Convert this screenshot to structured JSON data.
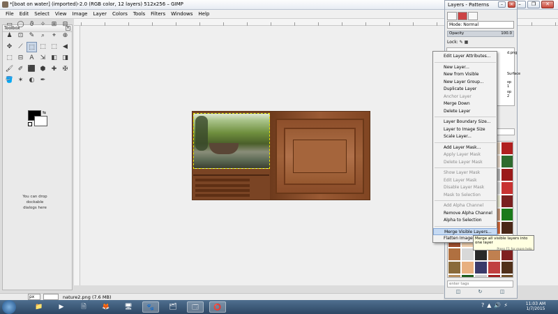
{
  "window": {
    "title": "*[boat on water] (imported)-2.0 (RGB color, 12 layers) 512x256 – GIMP",
    "buttons": [
      "–",
      "❐",
      "✕"
    ]
  },
  "menubar": [
    "File",
    "Edit",
    "Select",
    "View",
    "Image",
    "Layer",
    "Colors",
    "Tools",
    "Filters",
    "Windows",
    "Help"
  ],
  "toolbox": {
    "title": "Toolbox",
    "close_icon": "×",
    "tools": [
      "▭",
      "◯",
      "ϑ",
      "✧",
      "⊞",
      "⊟",
      "♟",
      "⊡",
      "✎",
      "⌕",
      "⌖",
      "⊕",
      "✥",
      "⟋",
      "⬚",
      "⬚",
      "⬚",
      "◀",
      "⬚",
      "⊟",
      "A",
      "⇲",
      "◧",
      "◨",
      "🖌",
      "✐",
      "⬛",
      "⬢",
      "✚",
      "✠",
      "🪣",
      "✶",
      "◐",
      "✒"
    ],
    "dropzone_text": "You can drop dockable dialogs here"
  },
  "status": {
    "unit": "px",
    "zoom": "",
    "text": "nature2.png (7.6 MB)"
  },
  "dock": {
    "title": "Layers - Patterns",
    "mode_label": "Mode: Normal",
    "opacity_label": "Opacity",
    "opacity_value": "100.0",
    "lock_label": "Lock:",
    "tags_placeholder": "enter tags",
    "layer_snippets": [
      "d.png",
      "Surface",
      "op 1",
      "op 2"
    ],
    "bottom_icons": [
      "◫",
      "↻",
      "◫"
    ]
  },
  "context_menu": {
    "items": [
      {
        "label": "Edit Layer Attributes...",
        "enabled": true
      },
      {
        "sep": true
      },
      {
        "label": "New Layer...",
        "enabled": true
      },
      {
        "label": "New from Visible",
        "enabled": true
      },
      {
        "label": "New Layer Group...",
        "enabled": true
      },
      {
        "label": "Duplicate Layer",
        "enabled": true
      },
      {
        "label": "Anchor Layer",
        "enabled": false
      },
      {
        "label": "Merge Down",
        "enabled": true
      },
      {
        "label": "Delete Layer",
        "enabled": true
      },
      {
        "sep": true
      },
      {
        "label": "Layer Boundary Size...",
        "enabled": true
      },
      {
        "label": "Layer to Image Size",
        "enabled": true
      },
      {
        "label": "Scale Layer...",
        "enabled": true
      },
      {
        "sep": true
      },
      {
        "label": "Add Layer Mask...",
        "enabled": true
      },
      {
        "label": "Apply Layer Mask",
        "enabled": false
      },
      {
        "label": "Delete Layer Mask",
        "enabled": false
      },
      {
        "sep": true
      },
      {
        "label": "Show Layer Mask",
        "enabled": false
      },
      {
        "label": "Edit Layer Mask",
        "enabled": false
      },
      {
        "label": "Disable Layer Mask",
        "enabled": false
      },
      {
        "label": "Mask to Selection",
        "enabled": false
      },
      {
        "sep": true
      },
      {
        "label": "Add Alpha Channel",
        "enabled": false
      },
      {
        "label": "Remove Alpha Channel",
        "enabled": true
      },
      {
        "label": "Alpha to Selection",
        "enabled": true
      },
      {
        "sep": true
      },
      {
        "label": "Merge Visible Layers...",
        "enabled": true,
        "highlighted": true
      },
      {
        "label": "Flatten Image",
        "enabled": true
      }
    ]
  },
  "tooltip": {
    "text": "Merge all visible layers into one layer",
    "hint": "Press F1 for more help"
  },
  "taskbar": {
    "apps": [
      "📁",
      "▶",
      "🗎",
      "🦊",
      "🖥",
      "🐾",
      "🗂",
      "🗔",
      "⭕"
    ],
    "clock_time": "11:03 AM",
    "clock_date": "1/7/2015",
    "tray": [
      "?",
      "▲",
      "🔊",
      "⚡"
    ]
  },
  "colors": {
    "accent": "#c6daf3",
    "pattern_swatches": [
      "#8a5a33",
      "#c97b4e",
      "#5a2d18",
      "#e9d6c2",
      "#b02020",
      "#3a2a1c",
      "#d4a07a",
      "#6b3b1f",
      "#f0e0d0",
      "#2e6b2e",
      "#a06b3f",
      "#e6b38c",
      "#4b2a14",
      "#c0c0c0",
      "#9b1b1b",
      "#704820",
      "#d9c09a",
      "#3a5a2a",
      "#e0e0e0",
      "#c83232",
      "#5a3a1a",
      "#b8865a",
      "#202020",
      "#f5f5dc",
      "#7a2020",
      "#8b6914",
      "#e8c8a0",
      "#2a4a6a",
      "#d0a080",
      "#1a7a1a",
      "#6a3a1a",
      "#c0a070",
      "#303030",
      "#e07040",
      "#4a2818",
      "#a05030",
      "#f0d0b0",
      "#1a1a5a",
      "#d05050",
      "#604020",
      "#b07040",
      "#d8d8d8",
      "#2a2a2a",
      "#c08050",
      "#802020",
      "#8a6a3a",
      "#e8b080",
      "#3a3a6a",
      "#c04040",
      "#50301a",
      "#b89060",
      "#1e5e1e",
      "#d0d0d0",
      "#a02020",
      "#70502a"
    ]
  }
}
